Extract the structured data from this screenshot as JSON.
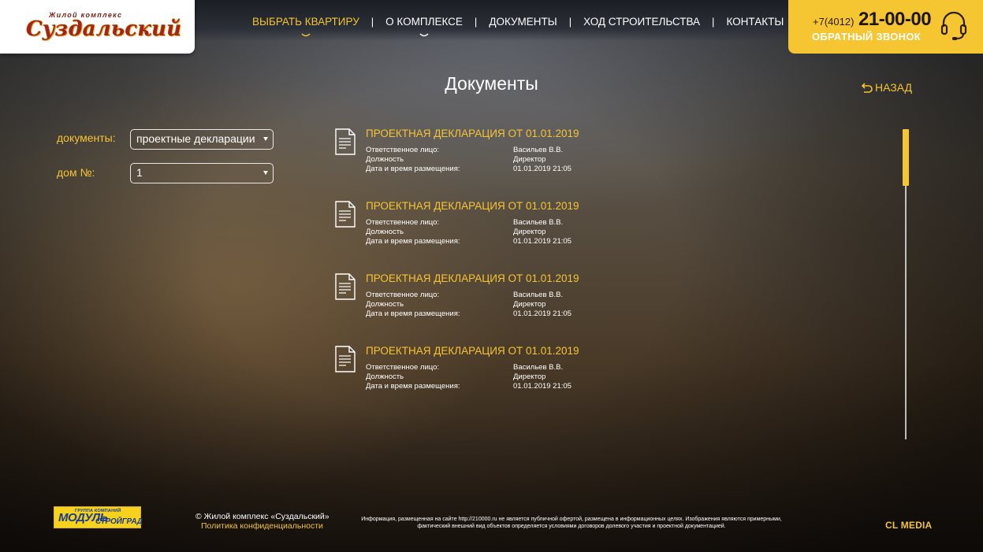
{
  "header": {
    "logo_small": "Жилой комплекс",
    "logo_big": "Суздальский",
    "nav": [
      {
        "label": "ВЫБРАТЬ КВАРТИРУ",
        "active": true,
        "has_dropdown": true
      },
      {
        "label": "О КОМПЛЕКСЕ",
        "active": false,
        "has_dropdown": true
      },
      {
        "label": "ДОКУМЕНТЫ",
        "active": false,
        "has_dropdown": false
      },
      {
        "label": "ХОД СТРОИТЕЛЬСТВА",
        "active": false,
        "has_dropdown": false
      },
      {
        "label": "КОНТАКТЫ",
        "active": false,
        "has_dropdown": false
      }
    ],
    "nav_separator": "|",
    "phone_code": "+7(4012)",
    "phone_number": "21-00-00",
    "callback_label": "ОБРАТНЫЙ ЗВОНОК"
  },
  "page": {
    "title": "Документы",
    "back_label": "НАЗАД"
  },
  "filters": {
    "documents_label": "документы:",
    "documents_value": "проектные декларации",
    "house_label": "дом №:",
    "house_value": "1"
  },
  "documents": [
    {
      "title": "ПРОЕКТНАЯ ДЕКЛАРАЦИЯ ОТ 01.01.2019",
      "rows": [
        {
          "label": "Ответственное лицо:",
          "value": "Васильев В.В."
        },
        {
          "label": "Должность",
          "value": "Директор"
        },
        {
          "label": "Дата и время размещения:",
          "value": "01.01.2019 21:05"
        }
      ]
    },
    {
      "title": "ПРОЕКТНАЯ ДЕКЛАРАЦИЯ ОТ 01.01.2019",
      "rows": [
        {
          "label": "Ответственное лицо:",
          "value": "Васильев В.В."
        },
        {
          "label": "Должность",
          "value": "Директор"
        },
        {
          "label": "Дата и время размещения:",
          "value": "01.01.2019 21:05"
        }
      ]
    },
    {
      "title": "ПРОЕКТНАЯ ДЕКЛАРАЦИЯ ОТ 01.01.2019",
      "rows": [
        {
          "label": "Ответственное лицо:",
          "value": "Васильев В.В."
        },
        {
          "label": "Должность",
          "value": "Директор"
        },
        {
          "label": "Дата и время размещения:",
          "value": "01.01.2019 21:05"
        }
      ]
    },
    {
      "title": "ПРОЕКТНАЯ ДЕКЛАРАЦИЯ ОТ 01.01.2019",
      "rows": [
        {
          "label": "Ответственное лицо:",
          "value": "Васильев В.В."
        },
        {
          "label": "Должность",
          "value": "Директор"
        },
        {
          "label": "Дата и время размещения:",
          "value": "01.01.2019 21:05"
        }
      ]
    }
  ],
  "footer": {
    "partner_small": "ГРУППА КОМПАНИЙ",
    "partner_big1": "МОДУЛЬ",
    "partner_big2": "СТРОЙГРАД",
    "copyright": "© Жилой комплекс «Суздальский»",
    "privacy": "Политика конфиденциальности",
    "disclaimer": "Информация, размещенная на сайте http://210000.ru не является публичной офертой, размещена в информационных целях. Изображения являются примерными, фактический внешний вид объектов определяется условиями договоров долевого участия и проектной документацией.",
    "agency": "CL MEDIA"
  },
  "colors": {
    "accent": "#f5c433",
    "phone_box": "#f6c532",
    "logo_red": "#a3241b"
  },
  "icons": {
    "document": "document-icon",
    "back": "back-arrow-icon",
    "headset": "headset-icon",
    "chevron": "chevron-down-icon",
    "select_arrow": "select-arrow-icon"
  }
}
